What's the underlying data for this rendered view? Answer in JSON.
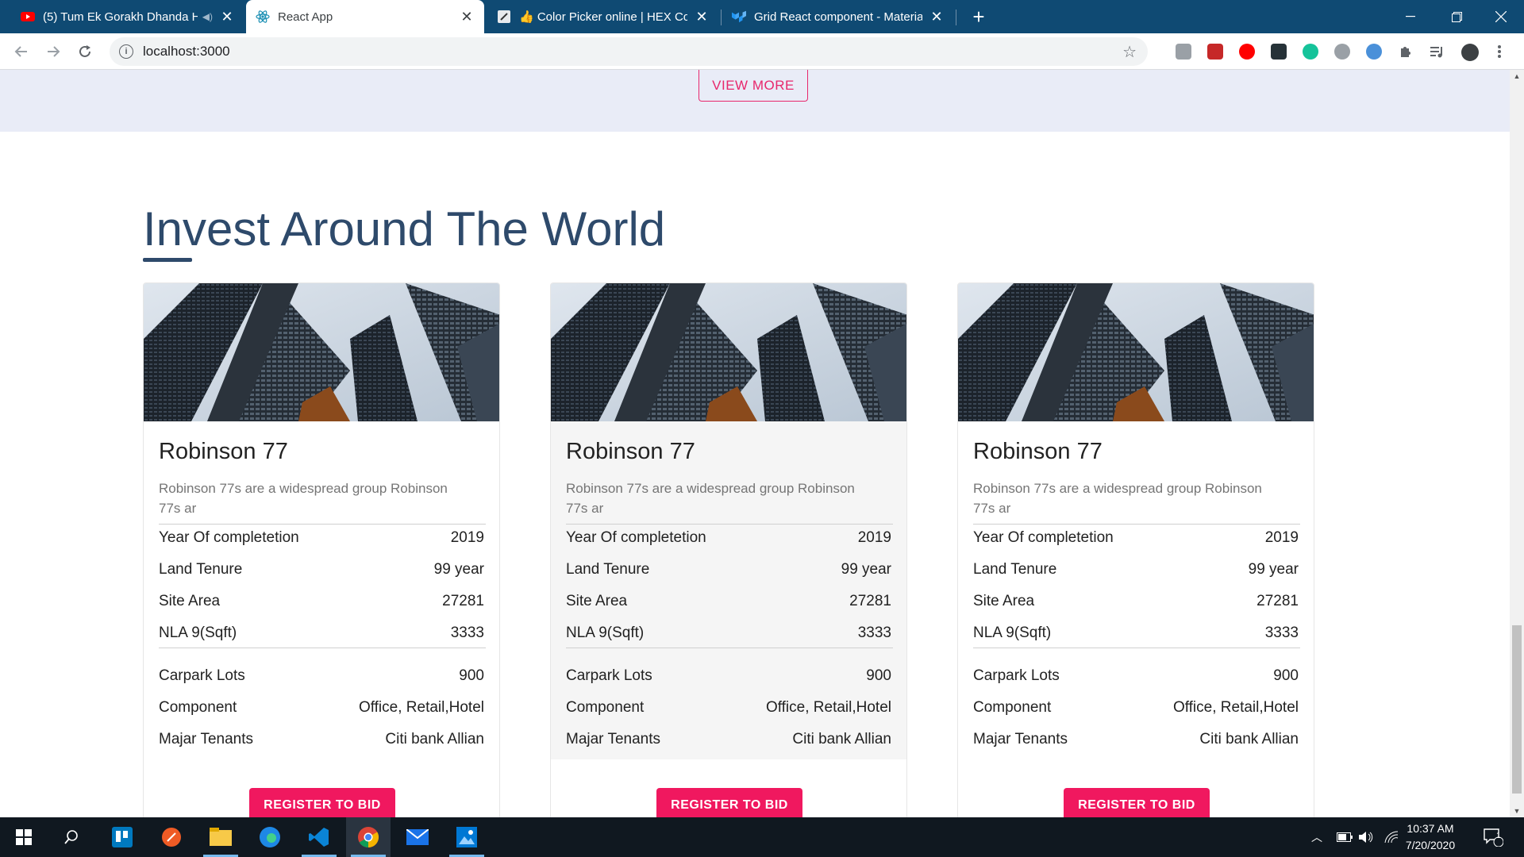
{
  "browser": {
    "tabs": [
      {
        "title": "(5) Tum Ek Gorakh Dhanda H",
        "active": false,
        "icon": "youtube-icon",
        "audio": true
      },
      {
        "title": "React App",
        "active": true,
        "icon": "react-icon"
      },
      {
        "title": "👍 Color Picker online | HEX Colo",
        "active": false,
        "icon": "color-picker-icon"
      },
      {
        "title": "Grid React component - Material",
        "active": false,
        "icon": "material-ui-icon"
      }
    ],
    "new_tab": "+",
    "url": "localhost:3000"
  },
  "page": {
    "view_more_label": "VIEW MORE",
    "section_title": "Invest Around The World",
    "register_label": "REGISTER TO BID",
    "cards": [
      {
        "title": "Robinson 77",
        "description": "Robinson 77s are a widespread group Robinson 77s ar",
        "rows_top": [
          {
            "label": "Year Of completetion",
            "value": "2019"
          },
          {
            "label": "Land Tenure",
            "value": "99 year"
          },
          {
            "label": "Site Area",
            "value": "27281"
          },
          {
            "label": "NLA 9(Sqft)",
            "value": "3333"
          }
        ],
        "rows_bottom": [
          {
            "label": "Carpark Lots",
            "value": "900"
          },
          {
            "label": "Component",
            "value": "Office, Retail,Hotel"
          },
          {
            "label": "Majar Tenants",
            "value": "Citi bank Allian"
          }
        ]
      },
      {
        "title": "Robinson 77",
        "description": "Robinson 77s are a widespread group Robinson 77s ar",
        "rows_top": [
          {
            "label": "Year Of completetion",
            "value": "2019"
          },
          {
            "label": "Land Tenure",
            "value": "99 year"
          },
          {
            "label": "Site Area",
            "value": "27281"
          },
          {
            "label": "NLA 9(Sqft)",
            "value": "3333"
          }
        ],
        "rows_bottom": [
          {
            "label": "Carpark Lots",
            "value": "900"
          },
          {
            "label": "Component",
            "value": "Office, Retail,Hotel"
          },
          {
            "label": "Majar Tenants",
            "value": "Citi bank Allian"
          }
        ]
      },
      {
        "title": "Robinson 77",
        "description": "Robinson 77s are a widespread group Robinson 77s ar",
        "rows_top": [
          {
            "label": "Year Of completetion",
            "value": "2019"
          },
          {
            "label": "Land Tenure",
            "value": "99 year"
          },
          {
            "label": "Site Area",
            "value": "27281"
          },
          {
            "label": "NLA 9(Sqft)",
            "value": "3333"
          }
        ],
        "rows_bottom": [
          {
            "label": "Carpark Lots",
            "value": "900"
          },
          {
            "label": "Component",
            "value": "Office, Retail,Hotel"
          },
          {
            "label": "Majar Tenants",
            "value": "Citi bank Allian"
          }
        ]
      }
    ]
  },
  "taskbar": {
    "time": "10:37 AM",
    "date": "7/20/2020",
    "notification_count": "1"
  },
  "colors": {
    "tabstrip": "#0f4a73",
    "accent_pink": "#f0185f",
    "title_blue": "#2e4a6b",
    "band": "#e9ecf7"
  }
}
